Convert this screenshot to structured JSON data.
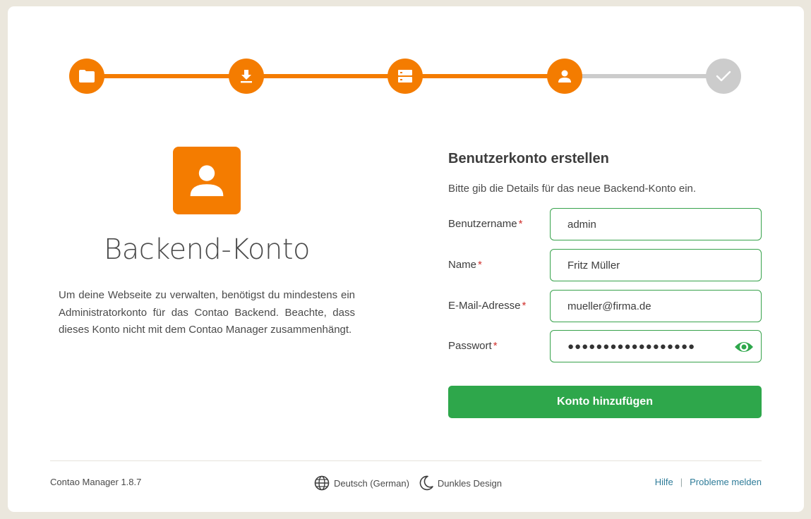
{
  "stepper": {
    "steps": [
      {
        "icon": "folder-icon",
        "state": "done"
      },
      {
        "icon": "download-icon",
        "state": "done"
      },
      {
        "icon": "server-icon",
        "state": "done"
      },
      {
        "icon": "user-icon",
        "state": "active"
      },
      {
        "icon": "check-icon",
        "state": "pending"
      }
    ]
  },
  "left": {
    "icon": "user-icon",
    "title": "Backend-Konto",
    "description": "Um deine Webseite zu verwalten, benötigst du mindestens ein Administratorkonto für das Contao Backend. Beachte, dass dieses Konto nicht mit dem Contao Manager zusammenhängt."
  },
  "form": {
    "title": "Benutzerkonto erstellen",
    "description": "Bitte gib die Details für das neue Backend-Konto ein.",
    "fields": {
      "username": {
        "label": "Benutzername",
        "required_mark": "*",
        "value": "admin"
      },
      "name": {
        "label": "Name",
        "required_mark": "*",
        "value": "Fritz Müller"
      },
      "email": {
        "label": "E-Mail-Adresse",
        "required_mark": "*",
        "value": "mueller@firma.de"
      },
      "password": {
        "label": "Passwort",
        "required_mark": "*",
        "value": "●●●●●●●●●●●●●●●●●●"
      }
    },
    "submit_label": "Konto hinzufügen"
  },
  "footer": {
    "version": "Contao Manager 1.8.7",
    "language": "Deutsch (German)",
    "theme": "Dunkles Design",
    "help": "Hilfe",
    "separator": "|",
    "report": "Probleme melden"
  },
  "colors": {
    "accent": "#f47c00",
    "success": "#2ea74b",
    "pending": "#cccccc",
    "link": "#2f7c99",
    "background": "#ebe7dd"
  }
}
